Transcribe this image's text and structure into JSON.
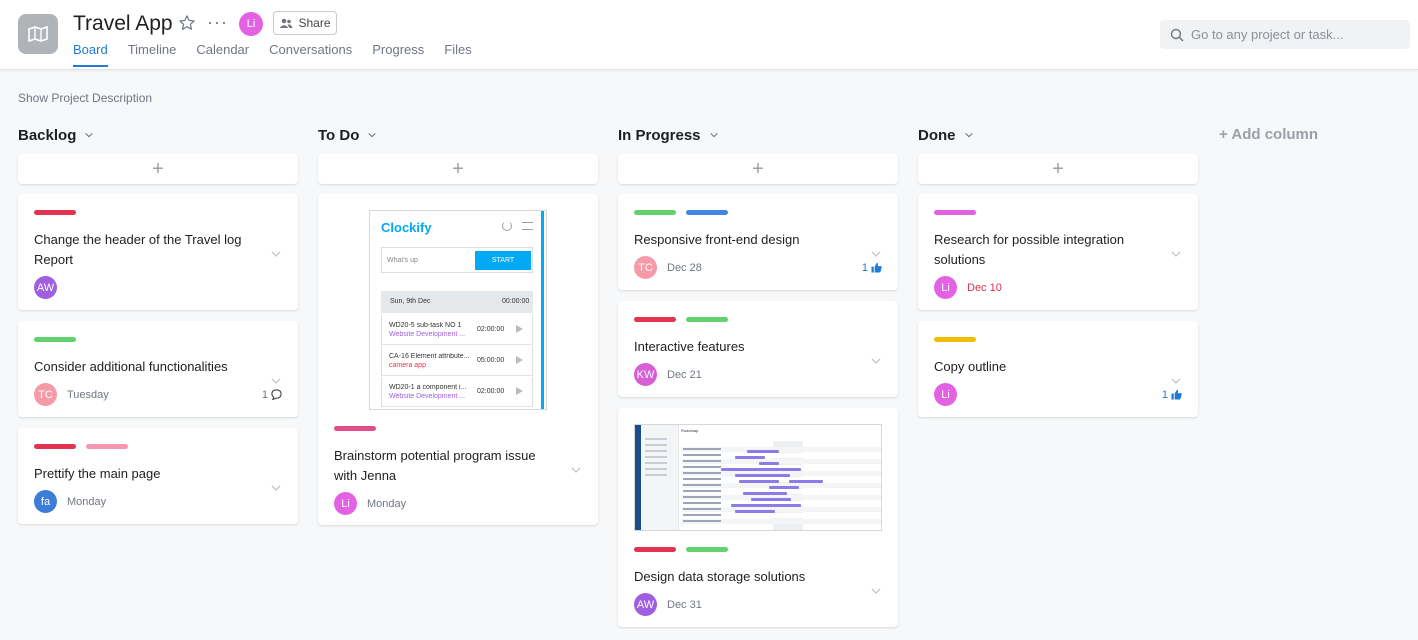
{
  "header": {
    "title": "Travel App",
    "avatar_initials": "Li",
    "share_label": "Share",
    "tabs": [
      "Board",
      "Timeline",
      "Calendar",
      "Conversations",
      "Progress",
      "Files"
    ],
    "active_tab": "Board",
    "search_placeholder": "Go to any project or task..."
  },
  "show_description": "Show Project Description",
  "add_column": "+ Add column",
  "columns": [
    {
      "name": "Backlog",
      "cards": [
        {
          "title": "Change the header of the Travel log Report",
          "tags": [
            "#e3344f"
          ],
          "avatar": "AW",
          "avatar_color": "#a05ee0",
          "date": "",
          "count": ""
        },
        {
          "title": "Consider additional functionalities",
          "tags": [
            "#62d26f"
          ],
          "avatar": "TC",
          "avatar_color": "#f59aa6",
          "date": "Tuesday",
          "count": "1"
        },
        {
          "title": "Prettify the main page",
          "tags": [
            "#e3344f",
            "#f597b3"
          ],
          "avatar": "fa",
          "avatar_color": "#3b7dd8",
          "date": "Monday",
          "count": ""
        }
      ]
    },
    {
      "name": "To Do",
      "cards": [
        {
          "title": "Brainstorm potential program issue with Jenna",
          "tags": [
            "#e44d8c"
          ],
          "avatar": "Li",
          "avatar_color": "#e362e3",
          "date": "Monday",
          "thumbnail": {
            "brand": "Clockify",
            "placeholder": "What's up",
            "start": "START",
            "day": "Sun, 9th Dec",
            "total": "00:00:00",
            "entries": [
              {
                "name": "WD20-5 sub-task NO 1",
                "project": "Website Development ...",
                "time": "02:00:00"
              },
              {
                "name": "CA-16 Element attribute...",
                "project": "camera app",
                "time": "05:00:00"
              },
              {
                "name": "WD20-1 a component i...",
                "project": "Website Development ...",
                "time": "02:00:00"
              }
            ]
          }
        }
      ]
    },
    {
      "name": "In Progress",
      "cards": [
        {
          "title": "Responsive front-end design",
          "tags": [
            "#62d26f",
            "#4186e0"
          ],
          "avatar": "TC",
          "avatar_color": "#f59aa6",
          "date": "Dec 28",
          "likes": "1"
        },
        {
          "title": "Interactive features",
          "tags": [
            "#e3344f",
            "#62d26f"
          ],
          "avatar": "KW",
          "avatar_color": "#d85ed6",
          "date": "Dec 21",
          "likes": ""
        },
        {
          "title": "Design data storage solutions",
          "tags": [
            "#e3344f",
            "#62d26f"
          ],
          "avatar": "AW",
          "avatar_color": "#a05ee0",
          "date": "Dec 31",
          "likes": "",
          "thumbnail": {
            "heading": "Roadmap"
          }
        }
      ]
    },
    {
      "name": "Done",
      "cards": [
        {
          "title": "Research for possible integration solutions",
          "tags": [
            "#e362e3"
          ],
          "avatar": "Li",
          "avatar_color": "#e362e3",
          "date": "Dec 10",
          "date_red": true,
          "likes": ""
        },
        {
          "title": "Copy outline",
          "tags": [
            "#f1bd00"
          ],
          "avatar": "Li",
          "avatar_color": "#e362e3",
          "date": "",
          "likes": "1"
        }
      ]
    }
  ]
}
